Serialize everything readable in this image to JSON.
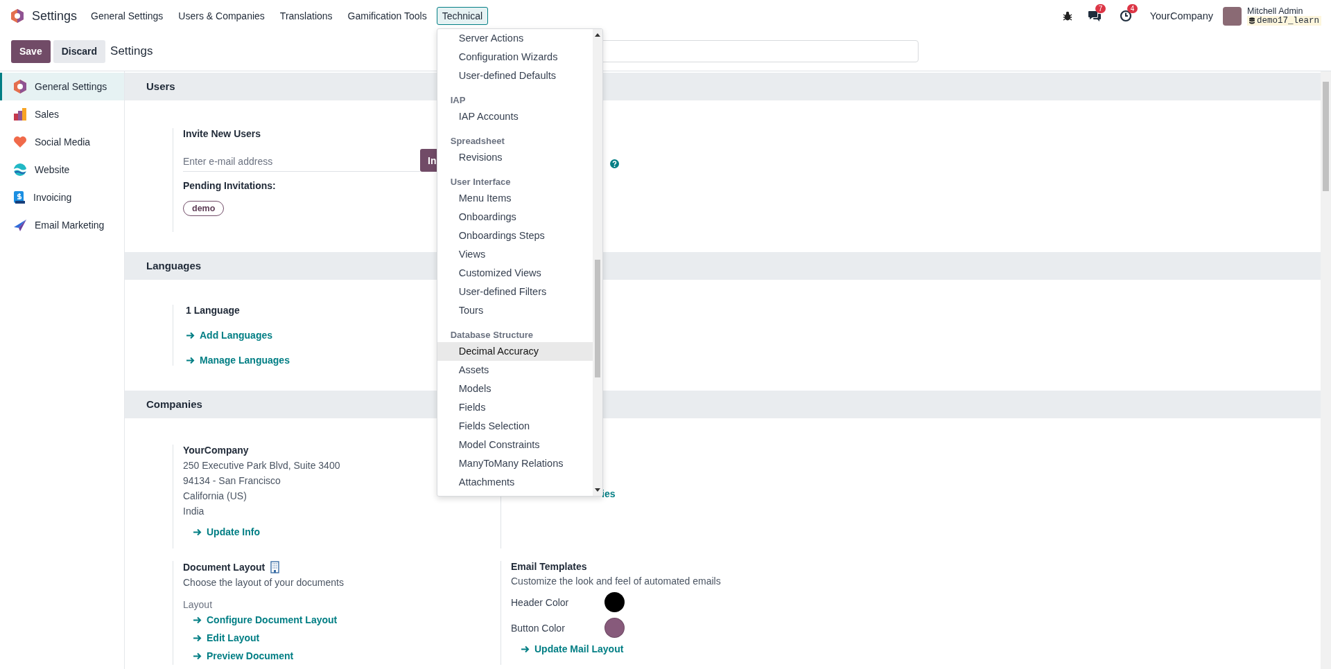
{
  "navbar": {
    "app_name": "Settings",
    "menus": [
      {
        "label": "General Settings",
        "selected": false
      },
      {
        "label": "Users & Companies",
        "selected": false
      },
      {
        "label": "Translations",
        "selected": false
      },
      {
        "label": "Gamification Tools",
        "selected": false
      },
      {
        "label": "Technical",
        "selected": true
      }
    ],
    "systray": {
      "messages_count": "7",
      "activities_count": "4",
      "company": "YourCompany",
      "user_name": "Mitchell Admin",
      "database": "demo17_learn"
    }
  },
  "control_panel": {
    "save": "Save",
    "discard": "Discard",
    "title": "Settings"
  },
  "technical_menu": {
    "groups": [
      {
        "items": [
          {
            "label": "Server Actions",
            "selected": false
          },
          {
            "label": "Configuration Wizards",
            "selected": false
          },
          {
            "label": "User-defined Defaults",
            "selected": false
          }
        ]
      },
      {
        "header": "IAP",
        "items": [
          {
            "label": "IAP Accounts",
            "selected": false
          }
        ]
      },
      {
        "header": "Spreadsheet",
        "items": [
          {
            "label": "Revisions",
            "selected": false
          }
        ]
      },
      {
        "header": "User Interface",
        "items": [
          {
            "label": "Menu Items",
            "selected": false
          },
          {
            "label": "Onboardings",
            "selected": false
          },
          {
            "label": "Onboardings Steps",
            "selected": false
          },
          {
            "label": "Views",
            "selected": false
          },
          {
            "label": "Customized Views",
            "selected": false
          },
          {
            "label": "User-defined Filters",
            "selected": false
          },
          {
            "label": "Tours",
            "selected": false
          }
        ]
      },
      {
        "header": "Database Structure",
        "items": [
          {
            "label": "Decimal Accuracy",
            "selected": true
          },
          {
            "label": "Assets",
            "selected": false
          },
          {
            "label": "Models",
            "selected": false
          },
          {
            "label": "Fields",
            "selected": false
          },
          {
            "label": "Fields Selection",
            "selected": false
          },
          {
            "label": "Model Constraints",
            "selected": false
          },
          {
            "label": "ManyToMany Relations",
            "selected": false
          },
          {
            "label": "Attachments",
            "selected": false
          }
        ]
      }
    ]
  },
  "sidebar": {
    "items": [
      {
        "label": "General Settings",
        "selected": true
      },
      {
        "label": "Sales",
        "selected": false
      },
      {
        "label": "Social Media",
        "selected": false
      },
      {
        "label": "Website",
        "selected": false
      },
      {
        "label": "Invoicing",
        "selected": false
      },
      {
        "label": "Email Marketing",
        "selected": false
      }
    ]
  },
  "users_section": {
    "title": "Users",
    "invite_label": "Invite New Users",
    "email_placeholder": "Enter e-mail address",
    "invite_button": "In",
    "pending_label": "Pending Invitations:",
    "pending": [
      "demo"
    ]
  },
  "languages_section": {
    "title": "Languages",
    "count": "1 Language",
    "links": [
      "Add Languages",
      "Manage Languages"
    ]
  },
  "companies_section": {
    "title": "Companies",
    "company_name": "YourCompany",
    "address": [
      "250 Executive Park Blvd, Suite 3400",
      "94134 - San Francisco",
      "California (US)",
      "India"
    ],
    "update_link": "Update Info",
    "companies_link": "ies",
    "document_layout": {
      "title": "Document Layout",
      "description": "Choose the layout of your documents",
      "layout_label": "Layout",
      "links": [
        "Configure Document Layout",
        "Edit Layout",
        "Preview Document"
      ]
    },
    "email_templates": {
      "title": "Email Templates",
      "description": "Customize the look and feel of automated emails",
      "colors": [
        {
          "label": "Header Color",
          "color": "#000000"
        },
        {
          "label": "Button Color",
          "color": "#875a7b"
        }
      ],
      "link": "Update Mail Layout"
    }
  }
}
